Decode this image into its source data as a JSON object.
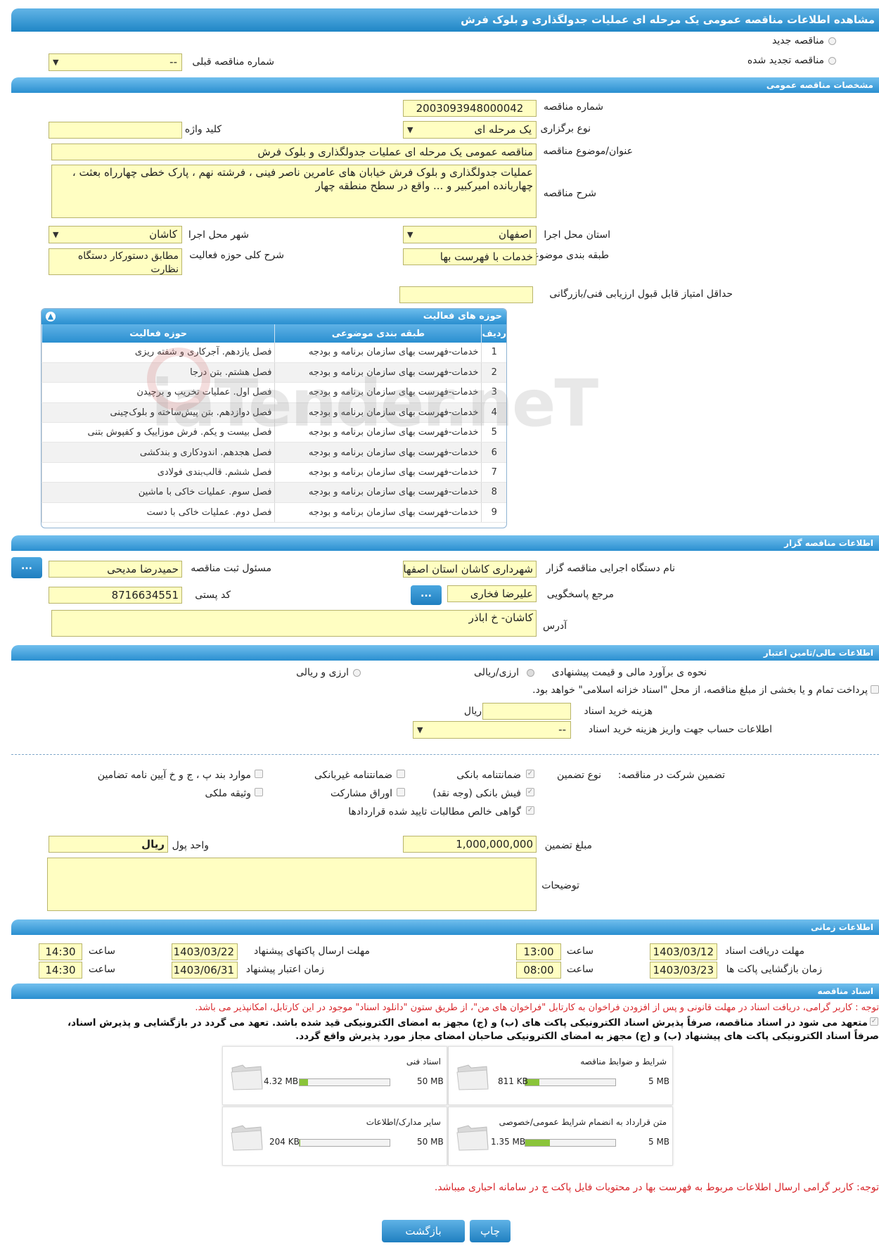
{
  "page_title": "مشاهده اطلاعات مناقصه عمومی یک مرحله ای عملیات جدولگذاری و بلوک فرش",
  "tender_kind": {
    "new": "مناقصه جدید",
    "renewed": "مناقصه تجدید شده",
    "prev_number_label": "شماره مناقصه قبلی",
    "prev_number_value": "--"
  },
  "general": {
    "header": "مشخصات مناقصه عمومی",
    "tender_number_label": "شماره مناقصه",
    "tender_number": "2003093948000042",
    "type_label": "نوع برگزاری",
    "type_value": "یک مرحله ای",
    "keyword_label": "کلید واژه",
    "keyword_value": "",
    "subject_label": "عنوان/موضوع مناقصه",
    "subject_value": "مناقصه عمومی یک مرحله ای عملیات جدولگذاری و بلوک فرش",
    "desc_label": "شرح مناقصه",
    "desc_value": "عملیات جدولگذاری و بلوک فرش خیابان های عامرین ناصر فینی ، فرشته نهم ، پارک خطی چهارراه بعثت ، چهاربانده امیرکبیر و ... واقع در سطح منطقه چهار",
    "province_label": "استان محل اجرا",
    "province_value": "اصفهان",
    "city_label": "شهر محل اجرا",
    "city_value": "کاشان",
    "category_label": "طبقه بندی موضوعی",
    "category_value": "خدمات با فهرست بها",
    "scope_label": "شرح کلی حوزه فعالیت",
    "scope_value": "مطابق دستورکار دستگاه نظارت",
    "min_score_label": "حداقل امتیاز قابل قبول ارزیابی فنی/بازرگانی",
    "min_score_value": ""
  },
  "activity": {
    "header": "حوزه های فعالیت",
    "col_row": "ردیف",
    "col_category": "طبقه بندی موضوعی",
    "col_scope": "حوزه فعالیت",
    "rows": [
      {
        "n": "1",
        "cat": "خدمات-فهرست بهای سازمان برنامه و بودجه",
        "scope": "فصل یازدهم. آجرکاری و شفته ریزی"
      },
      {
        "n": "2",
        "cat": "خدمات-فهرست بهای سازمان برنامه و بودجه",
        "scope": "فصل هشتم. بتن درجا"
      },
      {
        "n": "3",
        "cat": "خدمات-فهرست بهای سازمان برنامه و بودجه",
        "scope": "فصل اول. عملیات تخریب و برچیدن"
      },
      {
        "n": "4",
        "cat": "خدمات-فهرست بهای سازمان برنامه و بودجه",
        "scope": "فصل دوازدهم. بتن پیش‌ساخته و بلوک‌چینی"
      },
      {
        "n": "5",
        "cat": "خدمات-فهرست بهای سازمان برنامه و بودجه",
        "scope": "فصل بیست و یکم. فرش موزاییک و کفپوش بتنی"
      },
      {
        "n": "6",
        "cat": "خدمات-فهرست بهای سازمان برنامه و بودجه",
        "scope": "فصل هجدهم. اندودکاری و بندکشی"
      },
      {
        "n": "7",
        "cat": "خدمات-فهرست بهای سازمان برنامه و بودجه",
        "scope": "فصل ششم. قالب‌بندی فولادی"
      },
      {
        "n": "8",
        "cat": "خدمات-فهرست بهای سازمان برنامه و بودجه",
        "scope": "فصل سوم. عملیات خاکی با ماشین"
      },
      {
        "n": "9",
        "cat": "خدمات-فهرست بهای سازمان برنامه و بودجه",
        "scope": "فصل دوم. عملیات خاکی با دست"
      }
    ]
  },
  "organizer": {
    "header": "اطلاعات مناقصه گزار",
    "org_label": "نام دستگاه اجرایی مناقصه گزار",
    "org_value": "شهرداری کاشان استان اصفهان",
    "registrar_label": "مسئول ثبت مناقصه",
    "registrar_value": "حمیدرضا مدیحی",
    "responder_label": "مرجع پاسخگویی",
    "responder_value": "علیرضا فخاری",
    "postal_label": "کد پستی",
    "postal_value": "8716634551",
    "address_label": "آدرس",
    "address_value": "کاشان- خ اباذر",
    "dots": "..."
  },
  "finance": {
    "header": "اطلاعات مالی/تامین اعتبار",
    "estimate_label": "نحوه ی برآورد مالی و قیمت پیشنهادی",
    "opt_rial": "ارزی/ریالی",
    "opt_fx": "ارزی و ریالی",
    "treasury_text": "پرداخت تمام و یا بخشی از مبلغ مناقصه، از محل \"اسناد خزانه اسلامی\" خواهد بود.",
    "doc_fee_label": "هزینه خرید اسناد",
    "doc_fee_value": "",
    "rial": "ریال",
    "account_label": "اطلاعات حساب جهت واریز هزینه خرید اسناد",
    "account_value": "--"
  },
  "guarantee": {
    "label": "تضمین شرکت در مناقصه:",
    "type_label": "نوع تضمین",
    "opt1": "ضمانتنامه بانکی",
    "opt2": "ضمانتنامه غیربانکی",
    "opt3": "موارد بند پ ، ج و خ آیین نامه تضامین",
    "opt4": "فیش بانکی (وجه نقد)",
    "opt5": "اوراق مشارکت",
    "opt6": "وثیقه ملکی",
    "opt7": "گواهی خالص مطالبات تایید شده قراردادها",
    "amount_label": "مبلغ تضمین",
    "amount_value": "1,000,000,000",
    "currency_label": "واحد پول",
    "currency_value": "ریال",
    "notes_label": "توضیحات",
    "notes_value": ""
  },
  "timing": {
    "header": "اطلاعات زمانی",
    "doc_receive_label": "مهلت دریافت اسناد",
    "doc_receive_date": "1403/03/12",
    "doc_receive_time": "13:00",
    "send_label": "مهلت ارسال پاکتهای پیشنهاد",
    "send_date": "1403/03/22",
    "send_time": "14:30",
    "open_label": "زمان بازگشایی پاکت ها",
    "open_date": "1403/03/23",
    "open_time": "08:00",
    "valid_label": "زمان اعتبار پیشنهاد",
    "valid_date": "1403/06/31",
    "valid_time": "14:30",
    "time_label": "ساعت"
  },
  "docs": {
    "header": "اسناد مناقصه",
    "note1": "توجه : کاربر گرامی، دریافت اسناد در مهلت قانونی و پس از افزودن فراخوان به کارتابل \"فراخوان های من\"، از طریق ستون \"دانلود اسناد\" موجود در این کارتابل، امکانپذیر می باشد.",
    "commit1": "متعهد می شود در اسناد مناقصه، صرفاً پذیرش اسناد الکترونیکی پاکت های (ب) و (ج) مجهز به امضای الکترونیکی قید شده باشد. تعهد می گردد در بازگشایی و پذیرش اسناد،",
    "commit2": "صرفاً اسناد الکترونیکی پاکت های پیشنهاد (ب) و (ج) مجهز به امضای الکترونیکی صاحبان امضای مجاز مورد پذیرش واقع گردد.",
    "files": [
      {
        "title": "شرایط و ضوابط مناقصه",
        "size": "811 KB",
        "limit": "5 MB",
        "pct": 16
      },
      {
        "title": "اسناد فنی",
        "size": "4.32 MB",
        "limit": "50 MB",
        "pct": 9
      },
      {
        "title": "متن قرارداد به انضمام شرایط عمومی/خصوصی",
        "size": "1.35 MB",
        "limit": "5 MB",
        "pct": 27
      },
      {
        "title": "سایر مدارک/اطلاعات",
        "size": "204 KB",
        "limit": "50 MB",
        "pct": 1
      }
    ],
    "note2": "توجه: کاربر گرامی ارسال اطلاعات مربوط به فهرست بها در محتویات فایل پاکت ج در سامانه احباری میباشد."
  },
  "footer": {
    "print": "چاپ",
    "back": "بازگشت"
  },
  "colors": {
    "accent": "#1f86c6",
    "field": "#fffec2",
    "note": "#d8262b",
    "progress": "#8ac43a"
  }
}
